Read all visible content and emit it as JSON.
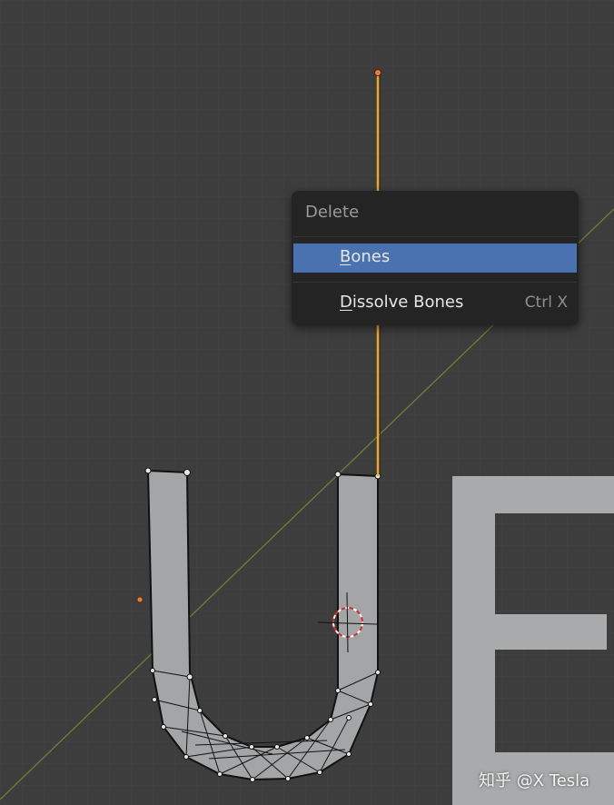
{
  "viewport": {
    "background_color": "#3d3d3d",
    "objects": [
      "armature-bone",
      "u-mesh",
      "e-text-object",
      "3d-cursor"
    ],
    "bone_color": "#f0a42a",
    "vertex_color": "#ff7a1a",
    "x_axis_color": "#6e7f36"
  },
  "context_menu": {
    "title": "Delete",
    "items": [
      {
        "underline": "B",
        "rest": "ones",
        "shortcut": "",
        "active": true
      },
      {
        "underline": "D",
        "rest": "issolve Bones",
        "shortcut": "Ctrl X",
        "active": false
      }
    ],
    "highlight_color": "#4a72b0"
  },
  "watermark": {
    "text": "知乎 @X Tesla"
  }
}
